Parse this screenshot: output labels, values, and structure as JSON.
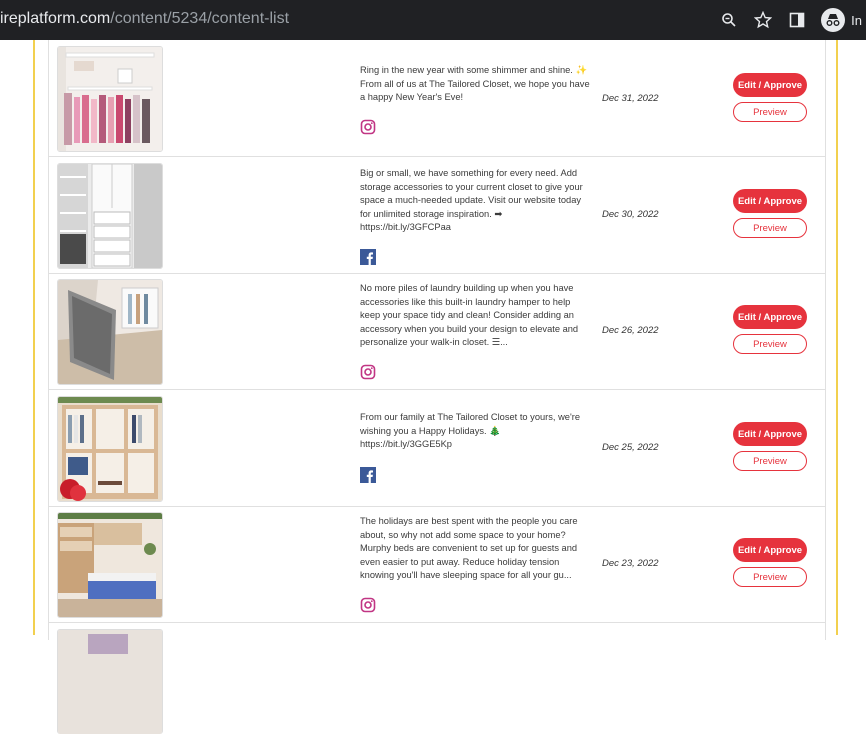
{
  "browser": {
    "url_host": "ireplatform.com",
    "url_path": "/content/5234/content-list",
    "profile_label": "In"
  },
  "colors": {
    "accent": "#e6333d",
    "frame": "#f2d04f",
    "instagram": "#c13584",
    "facebook": "#3b5998"
  },
  "posts": [
    {
      "caption": "Ring in the new year with some shimmer and shine. ✨ From all of us at The Tailored Closet, we hope you have a happy New Year's Eve!",
      "platform_icon": "instagram-icon",
      "date": "Dec 31, 2022",
      "edit_label": "Edit / Approve",
      "preview_label": "Preview"
    },
    {
      "caption": "Big or small, we have something for every need. Add storage accessories to your current closet to give your space a much-needed update. Visit our website today for unlimited storage inspiration. ➡ https://bit.ly/3GFCPaa",
      "platform_icon": "facebook-icon",
      "date": "Dec 30, 2022",
      "edit_label": "Edit / Approve",
      "preview_label": "Preview"
    },
    {
      "caption": "No more piles of laundry building up when you have accessories like this built-in laundry hamper to help keep your space tidy and clean! Consider adding an accessory when you build your design to elevate and personalize your walk-in closet. ☰...",
      "platform_icon": "instagram-icon",
      "date": "Dec 26, 2022",
      "edit_label": "Edit / Approve",
      "preview_label": "Preview"
    },
    {
      "caption": "From our family at The Tailored Closet to yours, we're wishing you a Happy Holidays. 🎄 https://bit.ly/3GGE5Kp",
      "platform_icon": "facebook-icon",
      "date": "Dec 25, 2022",
      "edit_label": "Edit / Approve",
      "preview_label": "Preview"
    },
    {
      "caption": "The holidays are best spent with the people you care about, so why not add some space to your home? Murphy beds are convenient to set up for guests and even easier to put away. Reduce holiday tension knowing you'll have sleeping space for all your gu...",
      "platform_icon": "instagram-icon",
      "date": "Dec 23, 2022",
      "edit_label": "Edit / Approve",
      "preview_label": "Preview"
    }
  ]
}
